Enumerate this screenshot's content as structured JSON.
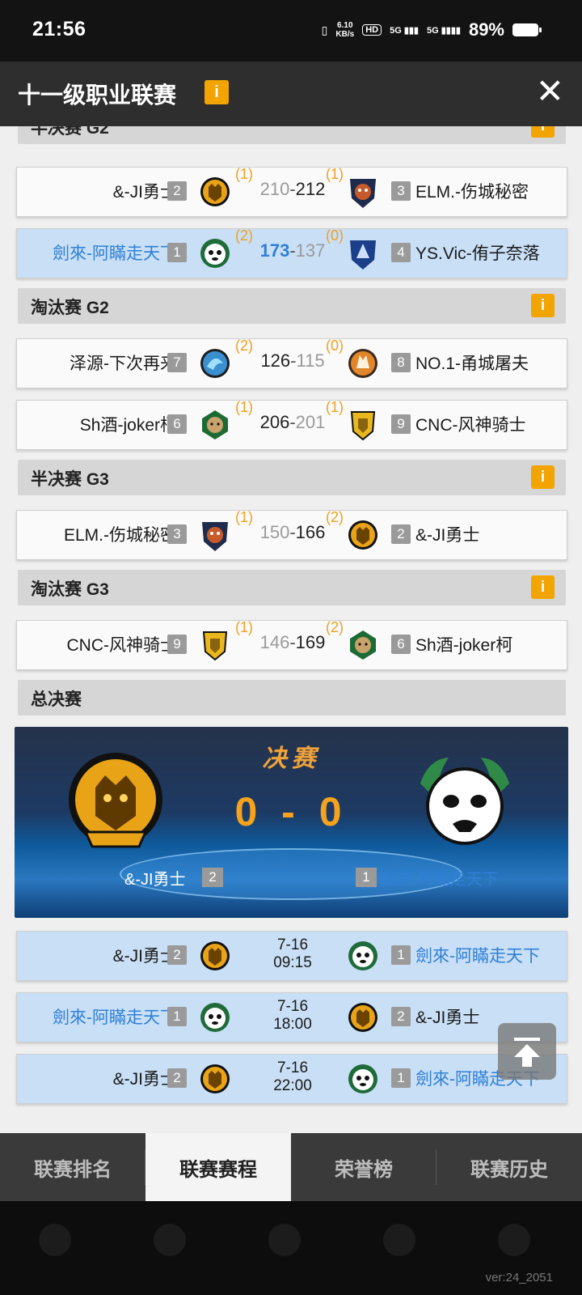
{
  "status": {
    "time": "21:56",
    "net_speed": "6.10",
    "net_unit": "KB/s",
    "hd": "HD",
    "sig1": "5G",
    "sig2": "5G",
    "battery": "89%"
  },
  "header": {
    "title": "十一级职业联赛",
    "info": "i",
    "close": "✕"
  },
  "rounds": [
    {
      "label": "半决赛 G2"
    },
    {
      "label": "淘汰赛 G2"
    },
    {
      "label": "半决赛 G3"
    },
    {
      "label": "淘汰赛 G3"
    },
    {
      "label": "总决赛"
    }
  ],
  "matches": [
    {
      "left": "&-JI勇士",
      "left_seed": "2",
      "left_wins": "(1)",
      "left_score": "210",
      "right_score": "212",
      "right_wins": "(1)",
      "right": "ELM.-伤城秘密",
      "right_seed": "3"
    },
    {
      "left": "劍來-阿瞞走天下",
      "left_seed": "1",
      "left_wins": "(2)",
      "left_score": "173",
      "right_score": "137",
      "right_wins": "(0)",
      "right": "YS.Vic-侑子奈落",
      "right_seed": "4"
    },
    {
      "left": "泽源-下次再来",
      "left_seed": "7",
      "left_wins": "(2)",
      "left_score": "126",
      "right_score": "115",
      "right_wins": "(0)",
      "right": "NO.1-甬城屠夫",
      "right_seed": "8"
    },
    {
      "left": "Sh酒-joker柯",
      "left_seed": "6",
      "left_wins": "(1)",
      "left_score": "206",
      "right_score": "201",
      "right_wins": "(1)",
      "right": "CNC-风神骑士",
      "right_seed": "9"
    },
    {
      "left": "ELM.-伤城秘密",
      "left_seed": "3",
      "left_wins": "(1)",
      "left_score": "150",
      "right_score": "166",
      "right_wins": "(2)",
      "right": "&-JI勇士",
      "right_seed": "2"
    },
    {
      "left": "CNC-风神骑士",
      "left_seed": "9",
      "left_wins": "(1)",
      "left_score": "146",
      "right_score": "169",
      "right_wins": "(2)",
      "right": "Sh酒-joker柯",
      "right_seed": "6"
    }
  ],
  "dash": "-",
  "final": {
    "title": "决赛",
    "score": "0 - 0",
    "left": "&-JI勇士",
    "left_seed": "2",
    "right": "劍來-阿瞞走天下",
    "right_seed": "1"
  },
  "schedule": [
    {
      "left": "&-JI勇士",
      "left_seed": "2",
      "date": "7-16",
      "time": "09:15",
      "right": "劍來-阿瞞走天下",
      "right_seed": "1"
    },
    {
      "left": "劍來-阿瞞走天下",
      "left_seed": "1",
      "date": "7-16",
      "time": "18:00",
      "right": "&-JI勇士",
      "right_seed": "2"
    },
    {
      "left": "&-JI勇士",
      "left_seed": "2",
      "date": "7-16",
      "time": "22:00",
      "right": "劍來-阿瞞走天下",
      "right_seed": "1"
    }
  ],
  "tabs": [
    "联赛排名",
    "联赛赛程",
    "荣誉榜",
    "联赛历史"
  ],
  "version": "ver:24_2051",
  "colors": {
    "accent": "#f2a400",
    "highlight_blue": "#2f7fd6",
    "win_bracket": "#f0a020"
  }
}
